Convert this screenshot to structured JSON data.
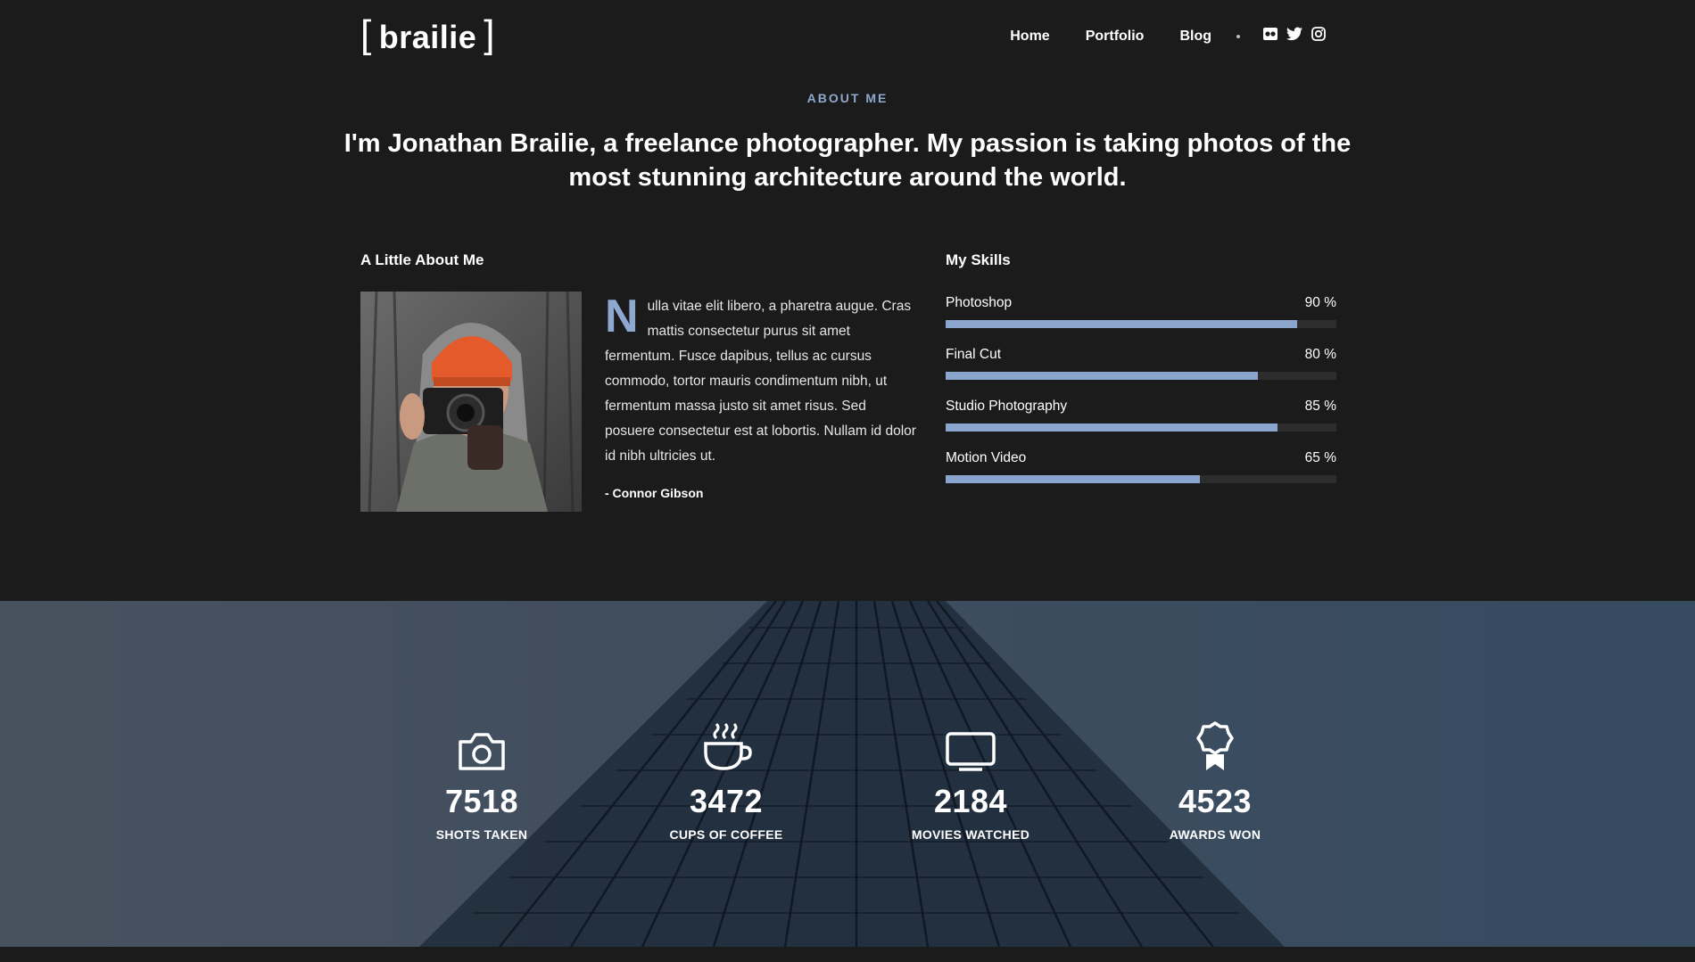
{
  "brand": {
    "logo_text": "brailie",
    "bracket_left": "[",
    "bracket_right": "]"
  },
  "nav": {
    "items": [
      "Home",
      "Portfolio",
      "Blog"
    ],
    "social_icons": [
      "flickr-icon",
      "twitter-icon",
      "instagram-icon"
    ]
  },
  "about": {
    "eyebrow": "ABOUT ME",
    "intro": "I'm Jonathan Brailie, a freelance photographer. My passion is taking photos of the most stunning architecture around the world."
  },
  "little_about": {
    "title": "A Little About Me",
    "drop_cap": "N",
    "bio": "ulla vitae elit libero, a pharetra augue. Cras mattis consectetur purus sit amet fermentum. Fusce dapibus, tellus ac cursus commodo, tortor mauris condimentum nibh, ut fermentum massa justo sit amet risus. Sed posuere consectetur est at lobortis. Nullam id dolor id nibh ultricies ut.",
    "signature": "- Connor Gibson"
  },
  "skills": {
    "title": "My Skills",
    "items": [
      {
        "name": "Photoshop",
        "percent_label": "90 %",
        "value": 90
      },
      {
        "name": "Final Cut",
        "percent_label": "80 %",
        "value": 80
      },
      {
        "name": "Studio Photography",
        "percent_label": "85 %",
        "value": 85
      },
      {
        "name": "Motion Video",
        "percent_label": "65 %",
        "value": 65
      }
    ]
  },
  "stats": [
    {
      "icon": "camera-icon",
      "number": "7518",
      "label": "SHOTS TAKEN"
    },
    {
      "icon": "coffee-cup-icon",
      "number": "3472",
      "label": "CUPS OF COFFEE"
    },
    {
      "icon": "monitor-icon",
      "number": "2184",
      "label": "MOVIES WATCHED"
    },
    {
      "icon": "award-icon",
      "number": "4523",
      "label": "AWARDS WON"
    }
  ],
  "colors": {
    "accent": "#8fa8cf",
    "background": "#1b1b1b",
    "bar_fill": "#8aa6cf"
  }
}
